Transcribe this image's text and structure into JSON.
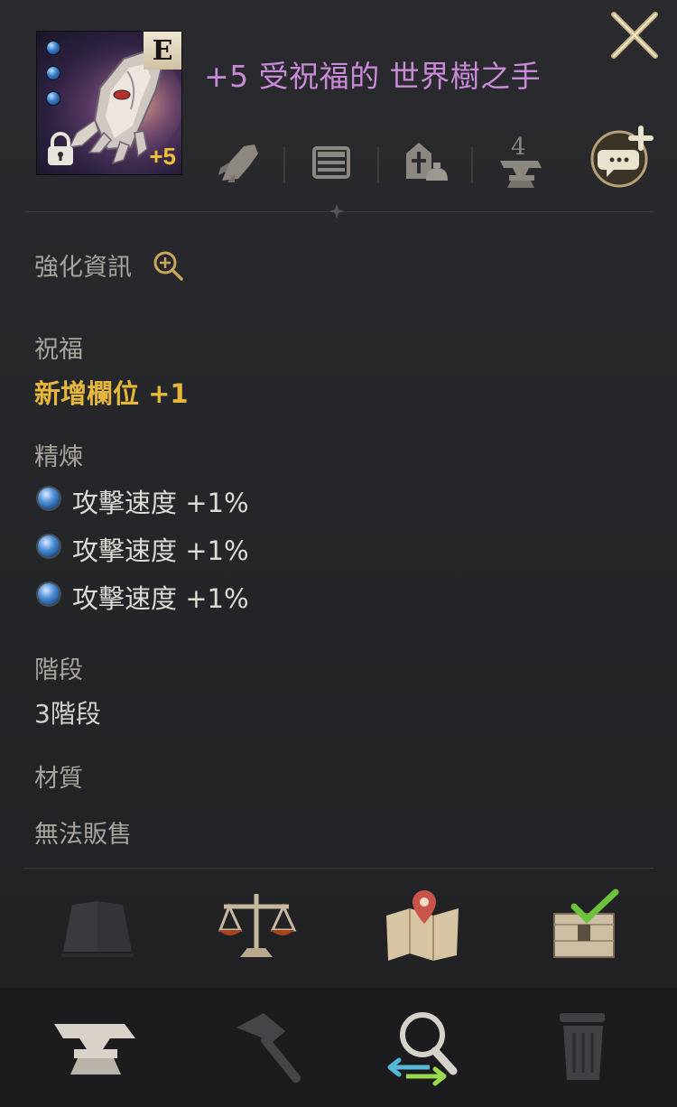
{
  "item": {
    "title": "+5 受祝福的 世界樹之手",
    "grade": "E",
    "enhance_level": "+5",
    "gem_slots": 3,
    "locked": true
  },
  "header_icons": {
    "storage_count": "4"
  },
  "sections": {
    "enhance_info_label": "強化資訊",
    "blessing_label": "祝福",
    "blessing_value": "新增欄位 +1",
    "refine_label": "精煉",
    "refine_stats": [
      {
        "text": "攻擊速度 +1%"
      },
      {
        "text": "攻擊速度 +1%"
      },
      {
        "text": "攻擊速度 +1%"
      }
    ],
    "tier_label": "階段",
    "tier_value": "3階段",
    "material_label": "材質",
    "trade_status": "無法販售"
  },
  "colors": {
    "title": "#c98ad8",
    "blessing": "#e6b73a",
    "enhance_level": "#f0c03a",
    "label": "#a9a49b",
    "background": "#242528"
  }
}
